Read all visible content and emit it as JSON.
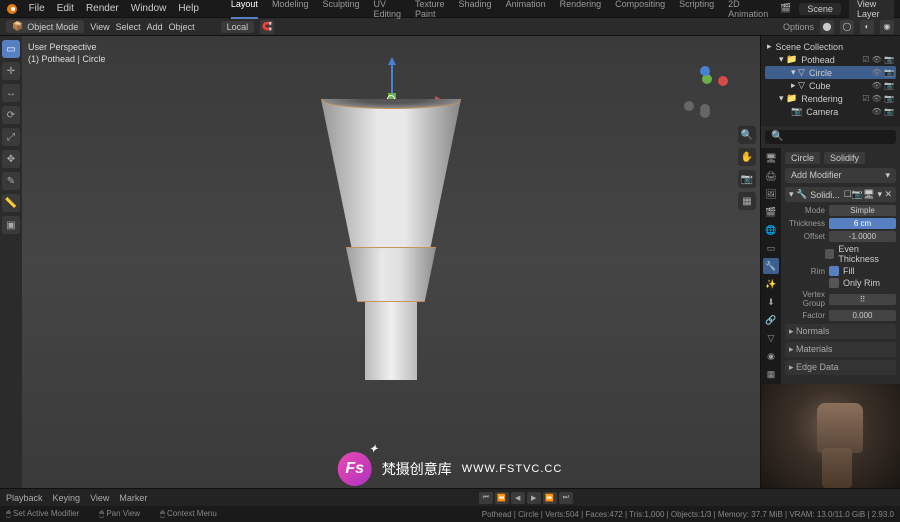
{
  "menu": [
    "File",
    "Edit",
    "Render",
    "Window",
    "Help"
  ],
  "workspaces": [
    "Layout",
    "Modeling",
    "Sculpting",
    "UV Editing",
    "Texture Paint",
    "Shading",
    "Animation",
    "Rendering",
    "Compositing",
    "Scripting",
    "2D Animation"
  ],
  "active_workspace": "Layout",
  "scene": {
    "scene": "Scene",
    "layer": "View Layer"
  },
  "header": {
    "mode": "Object Mode",
    "view": "View",
    "select": "Select",
    "add": "Add",
    "object": "Object",
    "global": "Local",
    "options": "Options"
  },
  "vp": {
    "line1": "User Perspective",
    "line2": "(1) Pothead | Circle"
  },
  "outliner": {
    "root": "Scene Collection",
    "items": [
      {
        "name": "Pothead",
        "children": [
          {
            "name": "Circle",
            "sel": true
          },
          {
            "name": "Cube"
          }
        ]
      },
      {
        "name": "Rendering",
        "children": [
          {
            "name": "Camera"
          }
        ]
      }
    ]
  },
  "search_placeholder": "",
  "modifier": {
    "breadcrumb": [
      "Circle",
      "Solidify"
    ],
    "add": "Add Modifier",
    "name": "Solidi...",
    "mode_lbl": "Mode",
    "mode": "Simple",
    "thick_lbl": "Thickness",
    "thick": "6 cm",
    "offset_lbl": "Offset",
    "offset": "-1.0000",
    "even": "Even Thickness",
    "rim_lbl": "Rim",
    "fill": "Fill",
    "only_rim": "Only Rim",
    "vg_lbl": "Vertex Group",
    "factor_lbl": "Factor",
    "factor": "0.000",
    "sections": [
      "Normals",
      "Materials",
      "Edge Data"
    ]
  },
  "timeline": {
    "playback": "Playback",
    "keying": "Keying",
    "view": "View",
    "marker": "Marker"
  },
  "status": {
    "set": "Set Active Modifier",
    "pan": "Pan View",
    "ctx": "Context Menu",
    "stats": "Pothead | Circle | Verts:504 | Faces:472 | Tris:1,000 | Objects:1/3 | Memory: 37.7 MiB | VRAM: 13.0/11.0 GiB | 2.93.0"
  },
  "watermark": {
    "logo": "Fs",
    "text": "梵摄创意库",
    "url": "WWW.FSTVC.CC"
  }
}
